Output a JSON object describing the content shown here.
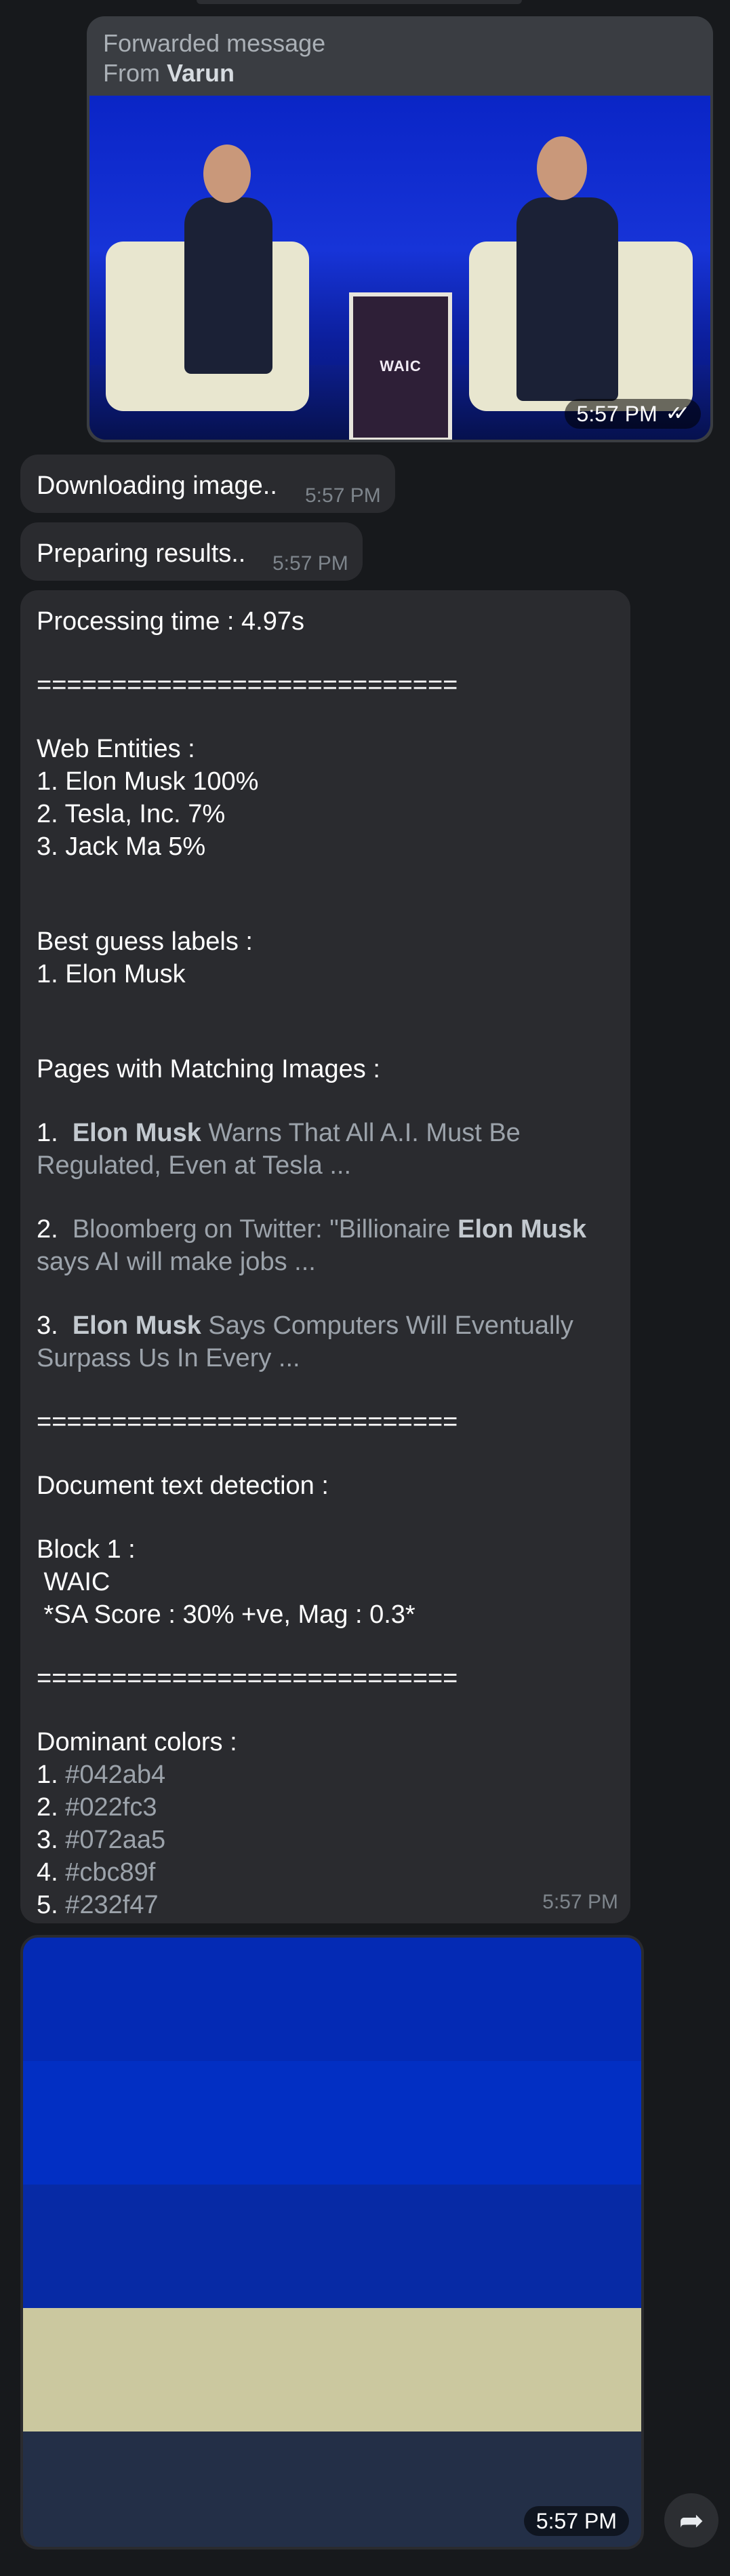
{
  "forwarded": {
    "header": "Forwarded message",
    "from_prefix": "From ",
    "from_name": "Varun",
    "time": "5:57 PM",
    "podium_text": "WAIC"
  },
  "downloading": {
    "text": "Downloading image..",
    "time": "5:57 PM"
  },
  "preparing": {
    "text": "Preparing results..",
    "time": "5:57 PM"
  },
  "results": {
    "processing_time": "Processing time : 4.97s",
    "separator": "============================",
    "web_entities_title": "Web Entities :",
    "web_entities": [
      "1. Elon Musk 100%",
      "2. Tesla, Inc. 7%",
      "3. Jack Ma 5%"
    ],
    "best_guess_title": "Best guess labels :",
    "best_guess": [
      "1. Elon Musk"
    ],
    "pages_title": "Pages with Matching Images :",
    "pages": [
      {
        "num": "1. ",
        "bold": "Elon Musk",
        "rest": " Warns That All A.I. Must Be",
        "line2": "Regulated, Even at Tesla ..."
      },
      {
        "num": "2. ",
        "pre": "Bloomberg on Twitter: \"Billionaire ",
        "bold": "Elon Musk",
        "line2": "says AI will make jobs ..."
      },
      {
        "num": "3. ",
        "bold": "Elon Musk",
        "rest": " Says Computers Will Eventually",
        "line2": "Surpass Us In Every ..."
      }
    ],
    "doc_title": "Document text detection :",
    "block_title": "Block 1 :",
    "block_text": " WAIC",
    "block_sa": " *SA Score : 30% +ve, Mag : 0.3*",
    "colors_title": "Dominant colors :",
    "colors": [
      {
        "num": "1. ",
        "hex": "#042ab4"
      },
      {
        "num": "2. ",
        "hex": "#022fc3"
      },
      {
        "num": "3. ",
        "hex": "#072aa5"
      },
      {
        "num": "4. ",
        "hex": "#cbc89f"
      },
      {
        "num": "5. ",
        "hex": "#232f47"
      }
    ],
    "time": "5:57 PM"
  },
  "colors_image": {
    "time": "5:57 PM"
  }
}
